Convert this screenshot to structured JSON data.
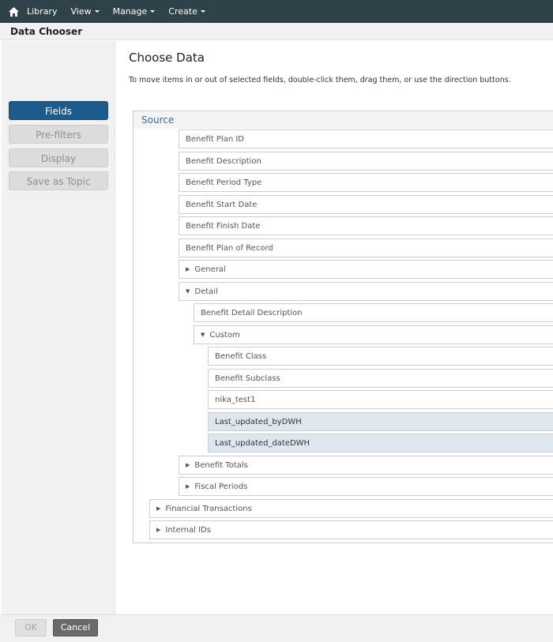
{
  "topbar": {
    "home_icon": "home-icon",
    "menus": [
      "Library",
      "View",
      "Manage",
      "Create"
    ]
  },
  "subheader": {
    "title": "Data Chooser"
  },
  "sidebar": {
    "items": [
      {
        "label": "Fields",
        "active": true
      },
      {
        "label": "Pre-filters",
        "active": false
      },
      {
        "label": "Display",
        "active": false
      },
      {
        "label": "Save as Topic",
        "active": false
      }
    ]
  },
  "main": {
    "title": "Choose Data",
    "instructions": "To move items in or out of selected fields, double-click them, drag them, or use the direction buttons.",
    "source": {
      "header": "Source",
      "items": [
        {
          "label": "Benefit Plan ID",
          "type": "field"
        },
        {
          "label": "Benefit Description",
          "type": "field"
        },
        {
          "label": "Benefit Period Type",
          "type": "field"
        },
        {
          "label": "Benefit Start Date",
          "type": "field"
        },
        {
          "label": "Benefit Finish Date",
          "type": "field"
        },
        {
          "label": "Benefit Plan of Record",
          "type": "field"
        },
        {
          "label": "General",
          "type": "folder",
          "expanded": false
        },
        {
          "label": "Detail",
          "type": "folder",
          "expanded": true
        },
        {
          "label": "Benefit Detail Description",
          "type": "field"
        },
        {
          "label": "Custom",
          "type": "folder",
          "expanded": true
        },
        {
          "label": "Benefit Class",
          "type": "field"
        },
        {
          "label": "Benefit Subclass",
          "type": "field"
        },
        {
          "label": "nika_test1",
          "type": "field"
        },
        {
          "label": "Last_updated_byDWH",
          "type": "field",
          "selected": true
        },
        {
          "label": "Last_updated_dateDWH",
          "type": "field",
          "selected": true
        },
        {
          "label": "Benefit Totals",
          "type": "folder",
          "expanded": false
        },
        {
          "label": "Fiscal Periods",
          "type": "folder",
          "expanded": false
        },
        {
          "label": "Financial Transactions",
          "type": "folder",
          "expanded": false
        },
        {
          "label": "Internal IDs",
          "type": "folder",
          "expanded": false
        }
      ]
    }
  },
  "footer": {
    "ok_label": "OK",
    "cancel_label": "Cancel"
  },
  "colors": {
    "topbar": "#2e4249",
    "active_button": "#1d5b8c",
    "selected_row": "#dfe7ee",
    "source_header_text": "#3a6f9a"
  }
}
